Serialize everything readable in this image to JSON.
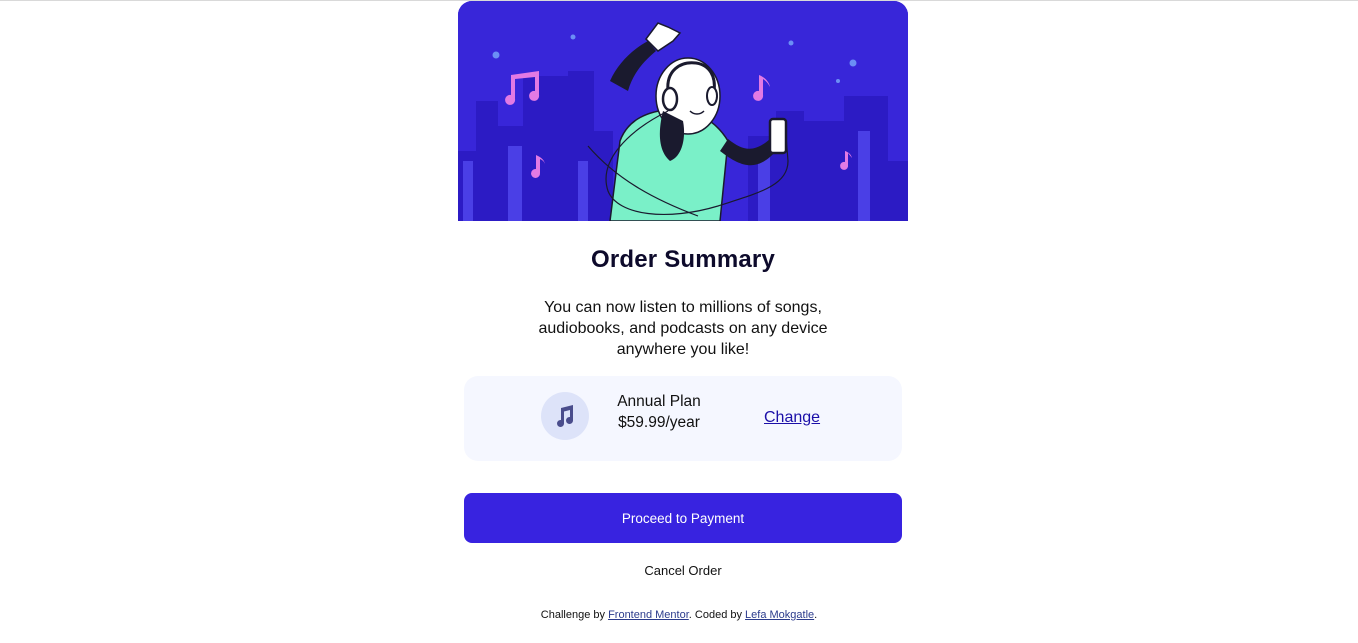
{
  "order": {
    "title": "Order Summary",
    "description": "You can now listen to millions of songs, audiobooks, and podcasts on any device anywhere you like!"
  },
  "plan": {
    "icon": "music-note-icon",
    "name": "Annual Plan",
    "price": "$59.99/year",
    "change_label": "Change"
  },
  "actions": {
    "proceed_label": "Proceed to Payment",
    "cancel_label": "Cancel Order"
  },
  "attribution": {
    "prefix": "Challenge by ",
    "challenge_link": "Frontend Mentor",
    "middle": ". Coded by ",
    "author_link": "Lefa Mokgatle",
    "suffix": "."
  },
  "colors": {
    "hero_background": "#3826d9",
    "primary_button": "#3823e0",
    "plan_background": "#f5f7ff",
    "link": "#1b0fa8"
  }
}
